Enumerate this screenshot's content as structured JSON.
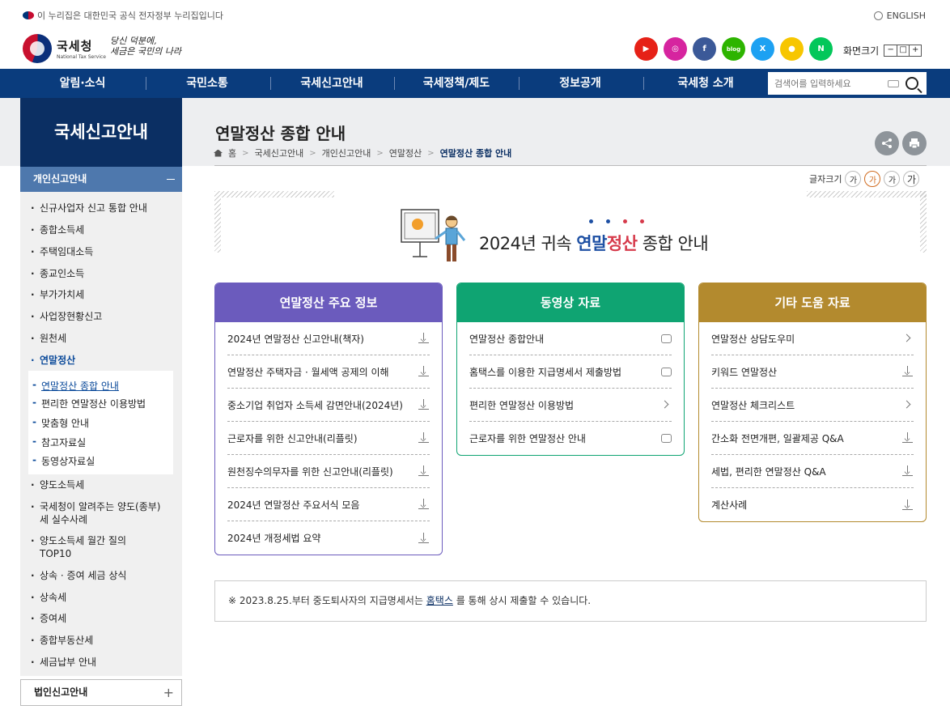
{
  "top": {
    "gov_notice": "이 누리집은 대한민국 공식 전자정부 누리집입니다",
    "english": "ENGLISH",
    "logo_ko": "국세청",
    "logo_en": "National Tax Service",
    "slogan_line1": "당신 덕분에,",
    "slogan_line2": "세금은 국민의 나라",
    "zoom_label": "화면크기",
    "zoom_btns": [
      "−",
      "□",
      "+"
    ]
  },
  "social": [
    {
      "name": "youtube",
      "glyph": "▶",
      "color": "#e62117"
    },
    {
      "name": "instagram",
      "glyph": "◎",
      "color": "#d6249f"
    },
    {
      "name": "facebook",
      "glyph": "f",
      "color": "#3b5998"
    },
    {
      "name": "blog",
      "glyph": "blog",
      "color": "#2db400"
    },
    {
      "name": "x",
      "glyph": "X",
      "color": "#1da1f2"
    },
    {
      "name": "kakao",
      "glyph": "●",
      "color": "#f7c600"
    },
    {
      "name": "naver",
      "glyph": "N",
      "color": "#03c75a"
    }
  ],
  "nav": [
    "알림·소식",
    "국민소통",
    "국세신고안내",
    "국세정책/제도",
    "정보공개",
    "국세청 소개"
  ],
  "search": {
    "placeholder": "검색어를 입력하세요"
  },
  "sidebar": {
    "title": "국세신고안내",
    "section": "개인신고안내",
    "items": [
      "신규사업자 신고 통합 안내",
      "종합소득세",
      "주택임대소득",
      "종교인소득",
      "부가가치세",
      "사업장현황신고",
      "원천세",
      "연말정산"
    ],
    "sub_items": [
      "연말정산 종합 안내",
      "편리한 연말정산 이용방법",
      "맞춤형 안내",
      "참고자료실",
      "동영상자료실"
    ],
    "items_after": [
      "양도소득세",
      "국세청이 알려주는 양도(종부)세 실수사례",
      "양도소득세 월간 질의 TOP10",
      "상속 · 증여 세금 상식",
      "상속세",
      "증여세",
      "종합부동산세",
      "세금납부 안내"
    ],
    "bottom": "법인신고안내"
  },
  "main": {
    "title": "연말정산 종합 안내",
    "breadcrumb": [
      "홈",
      "국세신고안내",
      "개인신고안내",
      "연말정산",
      "연말정산 종합 안내"
    ],
    "fontsize_label": "글자크기",
    "fontsize_btns": [
      "가",
      "가",
      "가",
      "가"
    ],
    "banner": {
      "prefix": "2024년 귀속 ",
      "blue": "연말",
      "red": "정산",
      "suffix": " 종합 안내"
    },
    "notice_prefix": "※ 2023.8.25.부터 중도퇴사자의 지급명세서는 ",
    "notice_link": "홈택스",
    "notice_suffix": " 를 통해 상시 제출할 수 있습니다."
  },
  "cards": [
    {
      "title": "연말정산 주요 정보",
      "color": "#6b5bbd",
      "items": [
        {
          "label": "2024년 연말정산 신고안내(책자)",
          "icon": "download"
        },
        {
          "label": "연말정산 주택자금 · 월세액 공제의 이해",
          "icon": "download"
        },
        {
          "label": "중소기업 취업자 소득세 감면안내(2024년)",
          "icon": "download"
        },
        {
          "label": "근로자를 위한 신고안내(리플릿)",
          "icon": "download"
        },
        {
          "label": "원천징수의무자를 위한 신고안내(리플릿)",
          "icon": "download"
        },
        {
          "label": "2024년 연말정산 주요서식 모음",
          "icon": "download"
        },
        {
          "label": "2024년 개정세법 요약",
          "icon": "download"
        }
      ]
    },
    {
      "title": "동영상 자료",
      "color": "#0fa472",
      "items": [
        {
          "label": "연말정산 종합안내",
          "icon": "video"
        },
        {
          "label": "홈택스를 이용한 지급명세서 제출방법",
          "icon": "video"
        },
        {
          "label": "편리한 연말정산 이용방법",
          "icon": "arrow"
        },
        {
          "label": "근로자를 위한 연말정산 안내",
          "icon": "video"
        }
      ]
    },
    {
      "title": "기타 도움 자료",
      "color": "#b38a2e",
      "items": [
        {
          "label": "연말정산 상담도우미",
          "icon": "arrow"
        },
        {
          "label": "키워드 연말정산",
          "icon": "download"
        },
        {
          "label": "연말정산 체크리스트",
          "icon": "arrow"
        },
        {
          "label": "간소화 전면개편, 일괄제공 Q&A",
          "icon": "download"
        },
        {
          "label": "세법, 편리한 연말정산 Q&A",
          "icon": "download"
        },
        {
          "label": "계산사례",
          "icon": "download"
        }
      ]
    }
  ]
}
